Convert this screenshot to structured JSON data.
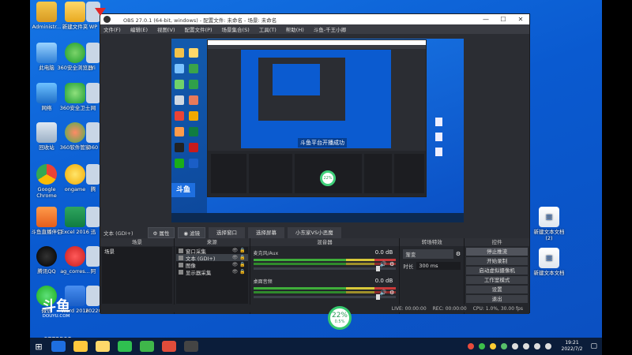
{
  "desktop": {
    "icons_left": [
      {
        "label": "Administr...",
        "icon": "user-folder-icon",
        "cls": "user"
      },
      {
        "label": "此电脑",
        "icon": "computer-icon",
        "cls": "pc"
      },
      {
        "label": "网络",
        "icon": "network-icon",
        "cls": "net"
      },
      {
        "label": "回收站",
        "icon": "recycle-bin-icon",
        "cls": "bin"
      },
      {
        "label": "Google Chrome",
        "icon": "chrome-icon",
        "cls": "chrome"
      },
      {
        "label": "斗鱼直播伴侣",
        "icon": "douyu-icon",
        "cls": "douyu"
      },
      {
        "label": "腾讯QQ",
        "icon": "qq-icon",
        "cls": "qq"
      },
      {
        "label": "微信",
        "icon": "wechat-icon",
        "cls": "wechat"
      }
    ],
    "icons_col2": [
      {
        "label": "新建文件夹",
        "icon": "folder-icon",
        "cls": "folder"
      },
      {
        "label": "360安全浏览器",
        "icon": "browser-360-icon",
        "cls": "e360"
      },
      {
        "label": "360安全卫士",
        "icon": "guard-360-icon",
        "cls": "guard"
      },
      {
        "label": "360软件管家",
        "icon": "software-manager-icon",
        "cls": "soft"
      },
      {
        "label": "ongame",
        "icon": "ongame-icon",
        "cls": "onga"
      },
      {
        "label": "Excel 2016",
        "icon": "excel-icon",
        "cls": "excel"
      },
      {
        "label": "ag_corres...",
        "icon": "ag-app-icon",
        "cls": "redc"
      },
      {
        "label": "Word 2016",
        "icon": "word-icon",
        "cls": "word"
      }
    ],
    "icons_col3_partial": [
      "WP",
      "Yi",
      "网",
      "360",
      "腾",
      "迅",
      "阿",
      "2022061..."
    ],
    "icons_right": [
      {
        "label": "新建文本文档 (2)",
        "icon": "text-file-icon"
      },
      {
        "label": "新建文本文档",
        "icon": "text-file-icon"
      }
    ]
  },
  "obs": {
    "title": "OBS 27.0.1 (64-bit, windows) - 配置文件: 未命名 - 场景: 未命名",
    "window_buttons": [
      "—",
      "☐",
      "✕"
    ],
    "menu": [
      "文件(F)",
      "编辑(E)",
      "视图(V)",
      "配置文件(P)",
      "场景集合(S)",
      "工具(T)",
      "帮助(H)",
      "斗鱼-千王小卿"
    ],
    "preview": {
      "overlay_text": "斗鱼平台开播成功",
      "circle_text": "22%"
    },
    "source_bar": {
      "label": "文本 (GDI+)",
      "properties": "属性",
      "filters": "滤镜",
      "tabs": [
        "选择窗口",
        "选择屏幕",
        "小东家VS小恶魔"
      ]
    },
    "scenes": {
      "header": "场景",
      "items": [
        "场景"
      ],
      "footer": [
        "+",
        "−",
        "∧",
        "∨"
      ]
    },
    "sources": {
      "header": "来源",
      "items": [
        {
          "label": "窗口采集",
          "icon": "window-capture-icon"
        },
        {
          "label": "文本 (GDI+)",
          "icon": "text-source-icon"
        },
        {
          "label": "图像",
          "icon": "image-source-icon"
        },
        {
          "label": "显示器采集",
          "icon": "display-capture-icon"
        }
      ],
      "footer": [
        "+",
        "−",
        "⚙",
        "∧",
        "∨"
      ]
    },
    "mixer": {
      "header": "混音器",
      "channels": [
        {
          "name": "麦克风/Aux",
          "value": "0.0 dB"
        },
        {
          "name": "桌面音频",
          "value": "0.0 dB"
        }
      ]
    },
    "transitions": {
      "header": "转场特效",
      "type": "渐变",
      "duration_label": "时长",
      "duration": "300 ms"
    },
    "controls": {
      "header": "控件",
      "buttons": [
        "停止推流",
        "开始录制",
        "启动虚拟摄像机",
        "工作室模式",
        "设置",
        "退出"
      ]
    },
    "status": {
      "live": "LIVE: 00:00:00",
      "rec": "REC: 00:00:00",
      "cpu": "CPU: 1.0%, 30.00 fps"
    }
  },
  "overlay": {
    "percent": "22%",
    "percent_sub": "0.5%"
  },
  "watermark": {
    "logo": "斗鱼",
    "sub": "DOUYU.COM",
    "room": "6772598"
  },
  "taskbar": {
    "time": "19:21",
    "date": "2022/7/2"
  }
}
